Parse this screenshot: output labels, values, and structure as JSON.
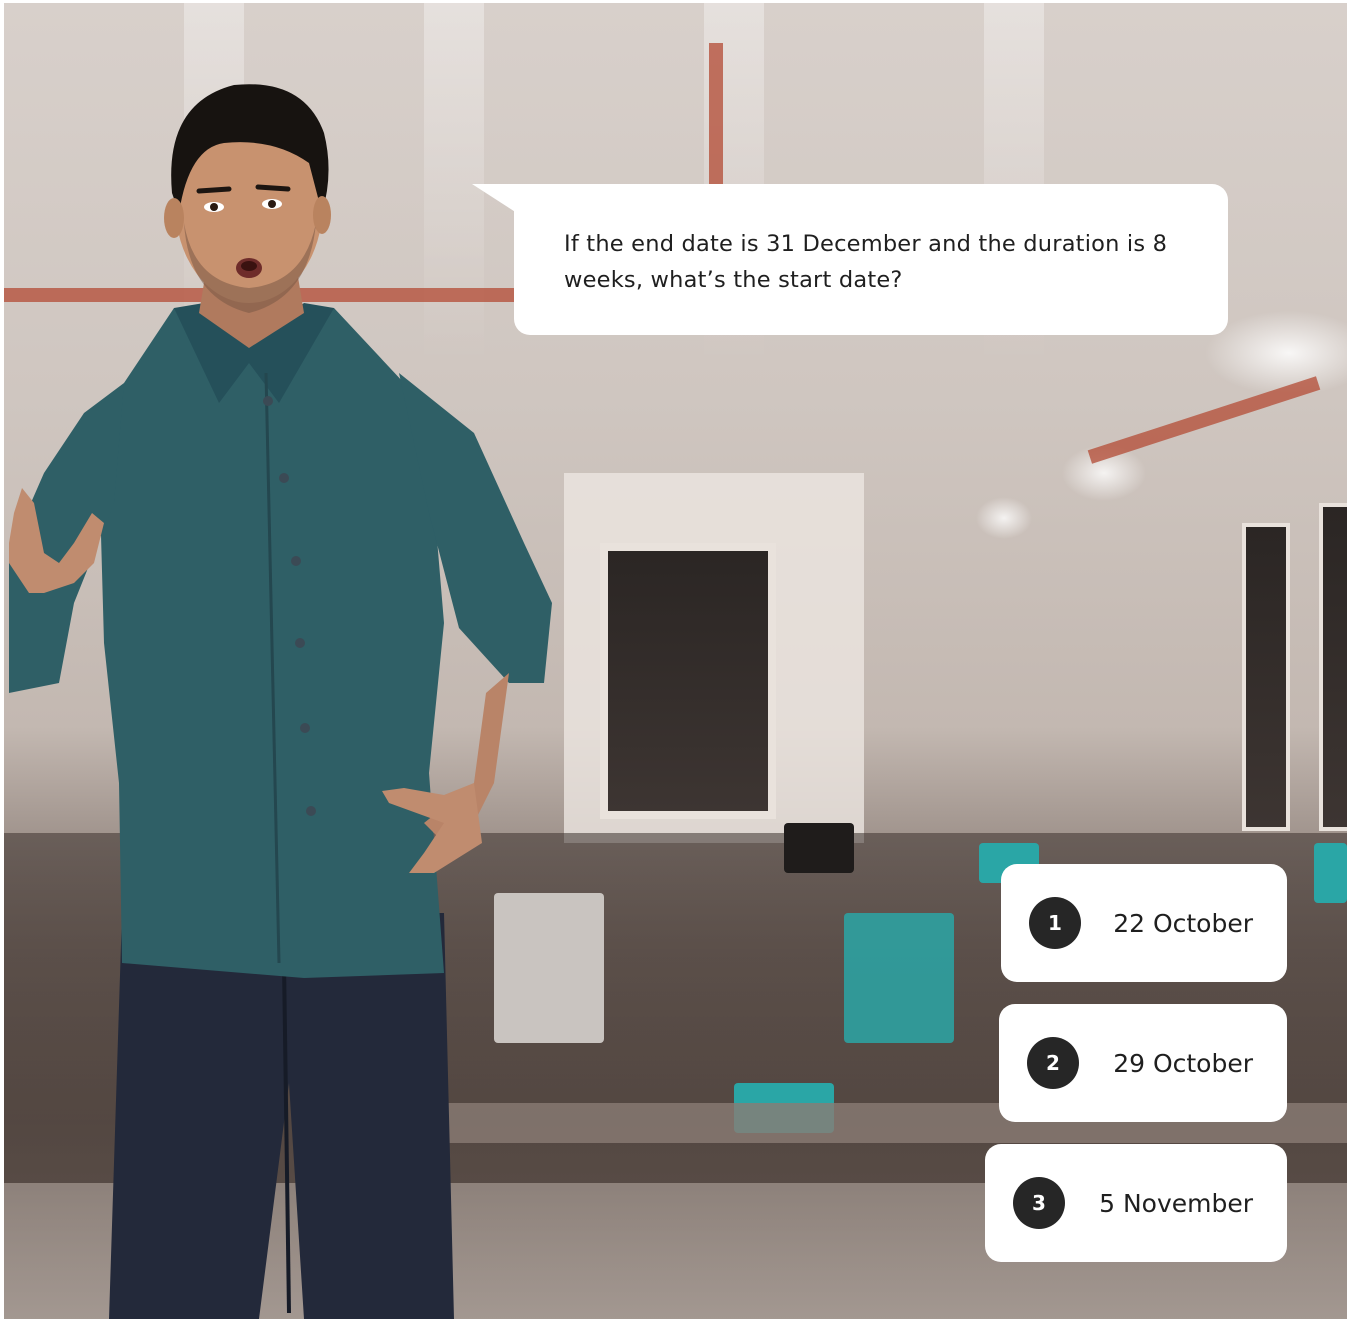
{
  "question": {
    "text": "If the end date is 31 December and the duration is 8 weeks, what’s the start date?"
  },
  "options": [
    {
      "number": "1",
      "label": "22 October"
    },
    {
      "number": "2",
      "label": "29 October"
    },
    {
      "number": "3",
      "label": "5 November"
    }
  ],
  "colors": {
    "badge": "#262626",
    "card": "#ffffff",
    "shirt": "#2f5f66",
    "jeans": "#23293a"
  }
}
